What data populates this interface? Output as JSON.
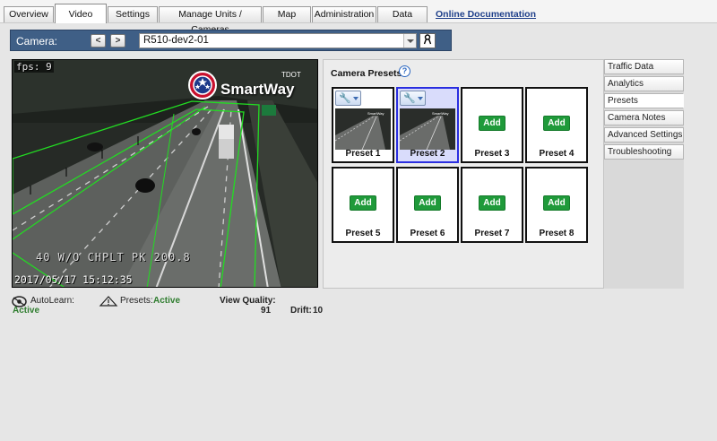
{
  "tabs": [
    {
      "label": "Overview",
      "active": false
    },
    {
      "label": "Video",
      "active": true
    },
    {
      "label": "Settings",
      "active": false
    },
    {
      "label": "Manage Units / Cameras",
      "active": false
    },
    {
      "label": "Map",
      "active": false
    },
    {
      "label": "Administration",
      "active": false
    },
    {
      "label": "Data",
      "active": false
    }
  ],
  "doc_link": "Online Documentation",
  "camera": {
    "label": "Camera:",
    "prev": "<",
    "next": ">",
    "selected": "R510-dev2-01"
  },
  "video": {
    "fps": "fps: 9",
    "road_text": "40 W/O CHPLT PK 200.8",
    "timestamp": "2017/05/17  15:12:35",
    "brand": "SmartWay",
    "brand_sub": "TDOT",
    "brand_icon": "tennessee-tristar-logo"
  },
  "presets": {
    "title": "Camera Presets",
    "help": "?",
    "add_label": "Add",
    "items": [
      {
        "label": "Preset 1",
        "has_image": true,
        "selected": false
      },
      {
        "label": "Preset 2",
        "has_image": true,
        "selected": true
      },
      {
        "label": "Preset 3",
        "has_image": false,
        "selected": false
      },
      {
        "label": "Preset 4",
        "has_image": false,
        "selected": false
      },
      {
        "label": "Preset 5",
        "has_image": false,
        "selected": false
      },
      {
        "label": "Preset 6",
        "has_image": false,
        "selected": false
      },
      {
        "label": "Preset 7",
        "has_image": false,
        "selected": false
      },
      {
        "label": "Preset 8",
        "has_image": false,
        "selected": false
      }
    ]
  },
  "side_menu": [
    {
      "label": "Traffic Data",
      "active": false
    },
    {
      "label": "Analytics",
      "active": false
    },
    {
      "label": "Presets",
      "active": true
    },
    {
      "label": "Camera Notes",
      "active": false
    },
    {
      "label": "Advanced Settings",
      "active": false
    },
    {
      "label": "Troubleshooting",
      "active": false
    }
  ],
  "status": {
    "autolearn_label": "AutoLearn:",
    "autolearn_value": "Active",
    "presets_label": "Presets:",
    "presets_value": "Active",
    "view_quality_label": "View Quality:",
    "view_quality_value": "91",
    "drift_label": "Drift:",
    "drift_value": "10"
  },
  "colors": {
    "camera_bar": "#3f5f86",
    "active_green": "#2f7d2f",
    "add_button": "#1f9a3a",
    "selected_border": "#2a2ee0",
    "overlay_green": "#22dd22"
  }
}
